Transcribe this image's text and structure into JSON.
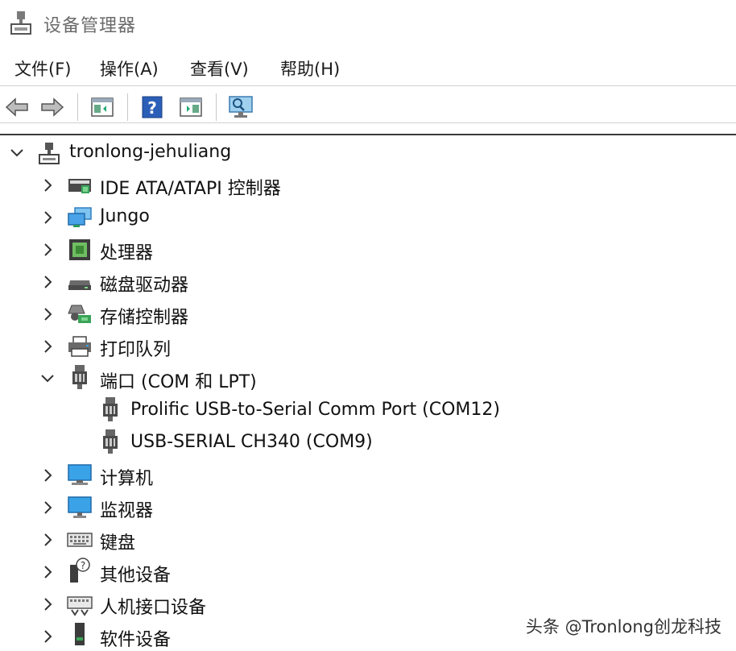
{
  "window": {
    "title": "设备管理器"
  },
  "menu": [
    {
      "label": "文件(F)"
    },
    {
      "label": "操作(A)"
    },
    {
      "label": "查看(V)"
    },
    {
      "label": "帮助(H)"
    }
  ],
  "toolbar": {
    "buttons": [
      {
        "name": "back-arrow-icon"
      },
      {
        "name": "forward-arrow-icon"
      },
      {
        "name": "properties-panel-icon"
      },
      {
        "name": "help-icon"
      },
      {
        "name": "update-driver-icon"
      },
      {
        "name": "scan-monitor-icon"
      }
    ]
  },
  "tree": {
    "root": {
      "label": "tronlong-jehuliang",
      "expanded": true
    },
    "items": [
      {
        "label": "IDE ATA/ATAPI 控制器",
        "icon": "ide-controller-icon",
        "expanded": false
      },
      {
        "label": "Jungo",
        "icon": "jungo-network-icon",
        "expanded": false
      },
      {
        "label": "处理器",
        "icon": "processor-icon",
        "expanded": false
      },
      {
        "label": "磁盘驱动器",
        "icon": "disk-drive-icon",
        "expanded": false
      },
      {
        "label": "存储控制器",
        "icon": "storage-controller-icon",
        "expanded": false
      },
      {
        "label": "打印队列",
        "icon": "printer-icon",
        "expanded": false
      },
      {
        "label": "端口 (COM 和 LPT)",
        "icon": "port-icon",
        "expanded": true,
        "children": [
          {
            "label": "Prolific USB-to-Serial Comm Port (COM12)",
            "icon": "port-icon"
          },
          {
            "label": "USB-SERIAL CH340 (COM9)",
            "icon": "port-icon"
          }
        ]
      },
      {
        "label": "计算机",
        "icon": "computer-icon",
        "expanded": false
      },
      {
        "label": "监视器",
        "icon": "monitor-icon",
        "expanded": false
      },
      {
        "label": "键盘",
        "icon": "keyboard-icon",
        "expanded": false
      },
      {
        "label": "其他设备",
        "icon": "unknown-device-icon",
        "expanded": false
      },
      {
        "label": "人机接口设备",
        "icon": "hid-icon",
        "expanded": false
      },
      {
        "label": "软件设备",
        "icon": "software-device-icon",
        "expanded": false
      }
    ]
  },
  "watermark": "头条 @Tronlong创龙科技"
}
